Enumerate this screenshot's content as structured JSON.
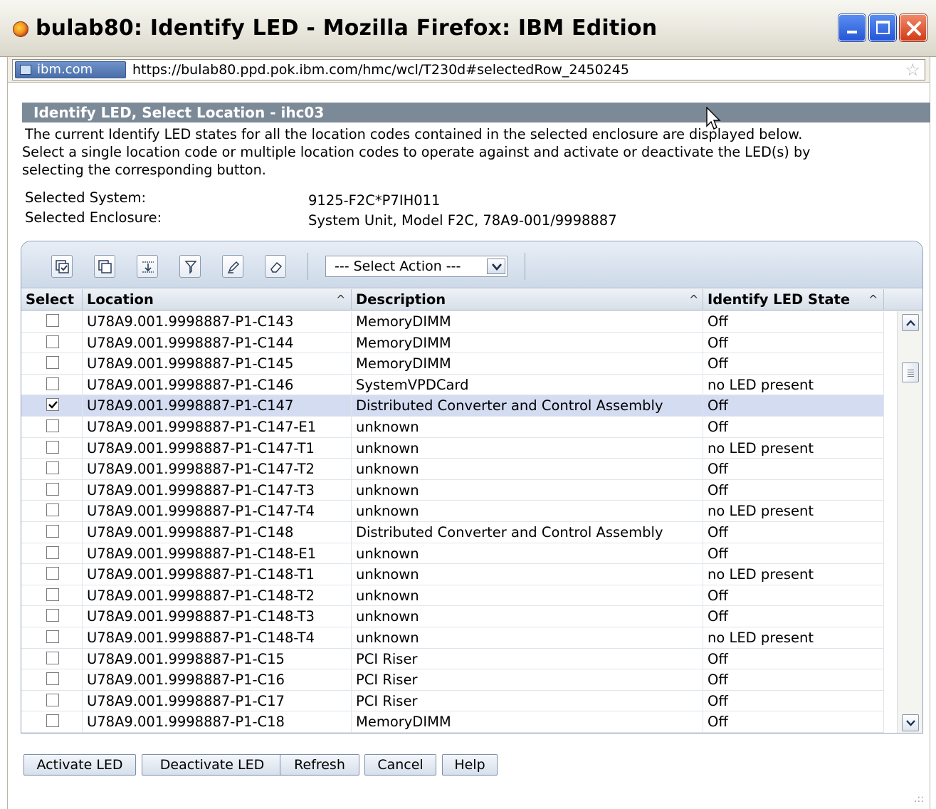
{
  "window": {
    "title": "bulab80: Identify LED - Mozilla Firefox: IBM Edition"
  },
  "addressbar": {
    "site": "ibm.com",
    "url": "https://bulab80.ppd.pok.ibm.com/hmc/wcl/T230d#selectedRow_2450245"
  },
  "panel": {
    "title": "Identify LED, Select Location - ihc03",
    "intro_lines": [
      "The current Identify LED states for all the location codes contained in the selected enclosure are displayed below.",
      "Select a single location code or multiple location codes to operate against and activate or deactivate the LED(s) by",
      "selecting the corresponding button."
    ],
    "system_label": "Selected System:",
    "system_value": "9125-F2C*P7IH011",
    "enclosure_label": "Selected Enclosure:",
    "enclosure_value": "System Unit, Model F2C, 78A9-001/9998887"
  },
  "toolbar": {
    "select_action": "--- Select Action ---"
  },
  "table": {
    "columns": [
      "Select",
      "Location",
      "Description",
      "Identify LED State"
    ],
    "rows": [
      {
        "checked": false,
        "location": "U78A9.001.9998887-P1-C143",
        "description": "MemoryDIMM",
        "state": "Off"
      },
      {
        "checked": false,
        "location": "U78A9.001.9998887-P1-C144",
        "description": "MemoryDIMM",
        "state": "Off"
      },
      {
        "checked": false,
        "location": "U78A9.001.9998887-P1-C145",
        "description": "MemoryDIMM",
        "state": "Off"
      },
      {
        "checked": false,
        "location": "U78A9.001.9998887-P1-C146",
        "description": "SystemVPDCard",
        "state": "no LED present"
      },
      {
        "checked": true,
        "location": "U78A9.001.9998887-P1-C147",
        "description": "Distributed Converter and Control Assembly",
        "state": "Off"
      },
      {
        "checked": false,
        "location": "U78A9.001.9998887-P1-C147-E1",
        "description": "unknown",
        "state": "Off"
      },
      {
        "checked": false,
        "location": "U78A9.001.9998887-P1-C147-T1",
        "description": "unknown",
        "state": "no LED present"
      },
      {
        "checked": false,
        "location": "U78A9.001.9998887-P1-C147-T2",
        "description": "unknown",
        "state": "Off"
      },
      {
        "checked": false,
        "location": "U78A9.001.9998887-P1-C147-T3",
        "description": "unknown",
        "state": "Off"
      },
      {
        "checked": false,
        "location": "U78A9.001.9998887-P1-C147-T4",
        "description": "unknown",
        "state": "no LED present"
      },
      {
        "checked": false,
        "location": "U78A9.001.9998887-P1-C148",
        "description": "Distributed Converter and Control Assembly",
        "state": "Off"
      },
      {
        "checked": false,
        "location": "U78A9.001.9998887-P1-C148-E1",
        "description": "unknown",
        "state": "Off"
      },
      {
        "checked": false,
        "location": "U78A9.001.9998887-P1-C148-T1",
        "description": "unknown",
        "state": "no LED present"
      },
      {
        "checked": false,
        "location": "U78A9.001.9998887-P1-C148-T2",
        "description": "unknown",
        "state": "Off"
      },
      {
        "checked": false,
        "location": "U78A9.001.9998887-P1-C148-T3",
        "description": "unknown",
        "state": "Off"
      },
      {
        "checked": false,
        "location": "U78A9.001.9998887-P1-C148-T4",
        "description": "unknown",
        "state": "no LED present"
      },
      {
        "checked": false,
        "location": "U78A9.001.9998887-P1-C15",
        "description": "PCI Riser",
        "state": "Off"
      },
      {
        "checked": false,
        "location": "U78A9.001.9998887-P1-C16",
        "description": "PCI Riser",
        "state": "Off"
      },
      {
        "checked": false,
        "location": "U78A9.001.9998887-P1-C17",
        "description": "PCI Riser",
        "state": "Off"
      },
      {
        "checked": false,
        "location": "U78A9.001.9998887-P1-C18",
        "description": "MemoryDIMM",
        "state": "Off"
      }
    ]
  },
  "buttons": {
    "activate": "Activate LED",
    "deactivate": "Deactivate LED",
    "refresh": "Refresh",
    "cancel": "Cancel",
    "help": "Help"
  }
}
